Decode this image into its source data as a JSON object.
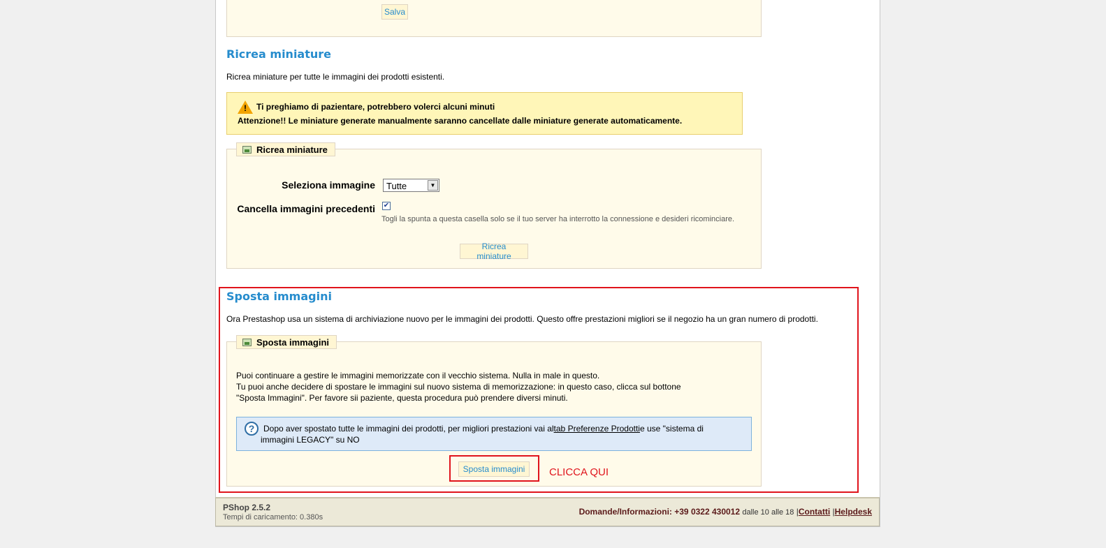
{
  "top_section": {
    "save_label": "Salva"
  },
  "regen": {
    "title": "Ricrea miniature",
    "description": "Ricrea miniature per tutte le immagini dei prodotti esistenti.",
    "warning_line1": "Ti preghiamo di pazientare, potrebbero volerci alcuni minuti",
    "warning_line2": "Attenzione!! Le miniature generate manualmente saranno cancellate dalle miniature generate automaticamente.",
    "legend": "Ricrea miniature",
    "select_label": "Seleziona immagine",
    "select_value": "Tutte",
    "checkbox_label": "Cancella immagini precedenti",
    "checkbox_checked": true,
    "checkbox_hint": "Togli la spunta a questa casella solo se il tuo server ha interrotto la connessione e desideri ricominciare.",
    "button_label": "Ricrea miniature"
  },
  "move": {
    "title": "Sposta immagini",
    "description": "Ora Prestashop usa un sistema di archiviazione nuovo per le immagini dei prodotti. Questo offre prestazioni migliori se il negozio ha un gran numero di prodotti.",
    "legend": "Sposta immagini",
    "para1": "Puoi continuare a gestire le immagini memorizzate con il vecchio sistema. Nulla in male in questo.",
    "para2": "Tu puoi anche decidere di spostare le immagini sul nuovo sistema di memorizzazione: in questo caso, clicca sul bottone",
    "para3": "\"Sposta Immagini\". Per favore sii paziente, questa procedura può prendere diversi minuti.",
    "hint_before": "Dopo aver spostato tutte le immagini dei prodotti, per migliori prestazioni vai al",
    "hint_link": "tab Preferenze Prodotti",
    "hint_after": "e use \"sistema di",
    "hint_line2": "immagini LEGACY\" su NO",
    "button_label": "Sposta immagini",
    "annotation": "CLICCA QUI"
  },
  "footer": {
    "version": "PShop 2.5.2",
    "load_time": "Tempi di caricamento: 0.380s",
    "contact_label": "Domande/Informazioni:",
    "phone": "+39 0322 430012",
    "hours": "dalle 10 alle 18",
    "sep": "|",
    "contacts_link": "Contatti",
    "helpdesk_link": "Helpdesk"
  },
  "colors": {
    "accent": "#268ccd",
    "annotation": "#e0141c"
  }
}
